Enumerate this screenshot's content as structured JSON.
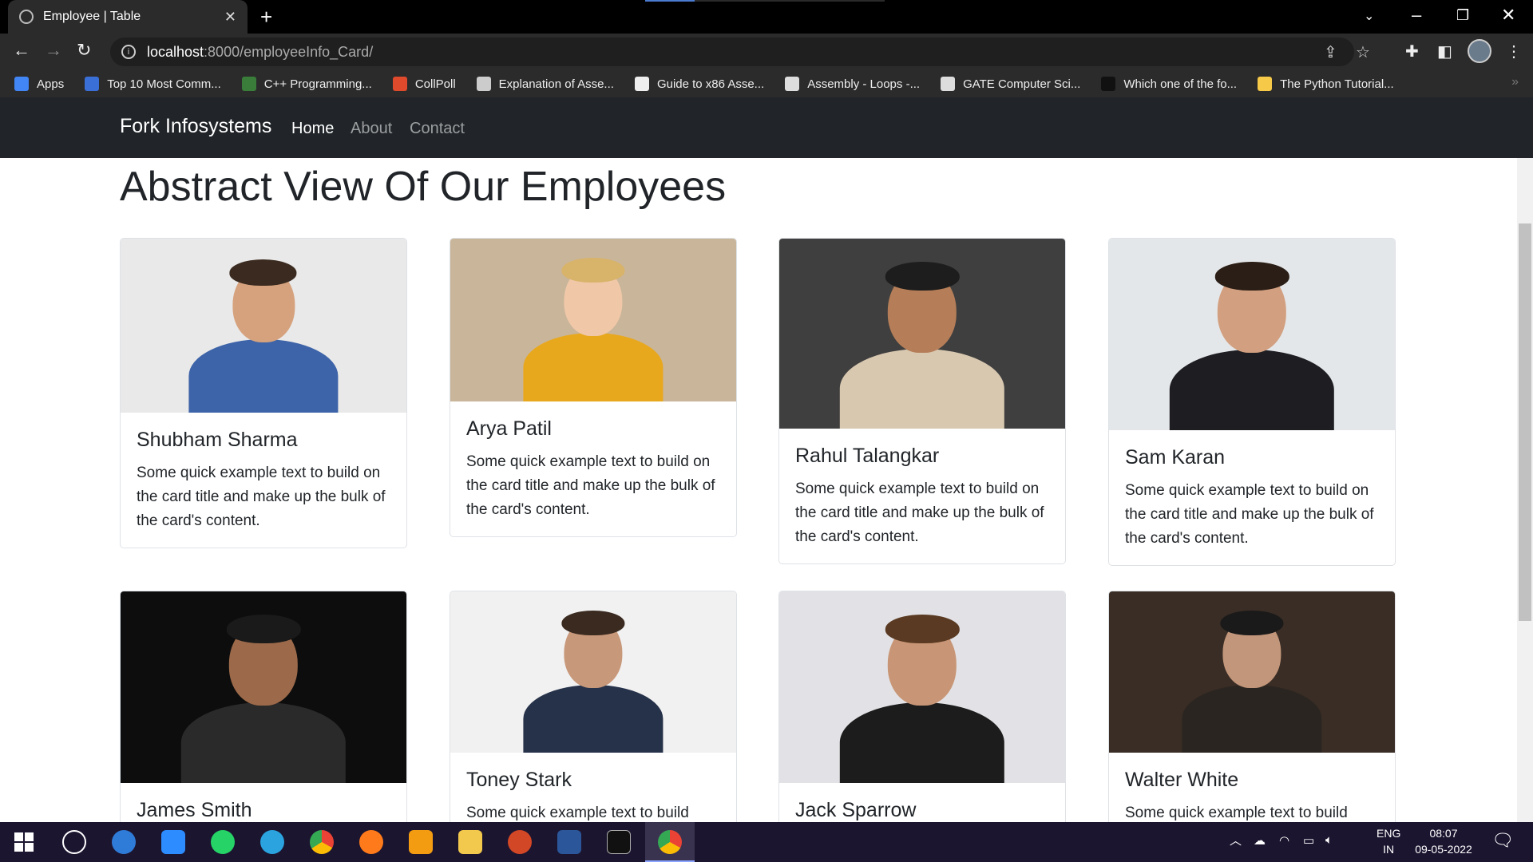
{
  "browser": {
    "tab_title": "Employee | Table",
    "url_host": "localhost",
    "url_rest": ":8000/employeeInfo_Card/",
    "bookmarks": [
      {
        "label": "Apps",
        "color": "#4285f4"
      },
      {
        "label": "Top 10 Most Comm...",
        "color": "#3b6fd8"
      },
      {
        "label": "C++ Programming...",
        "color": "#3a7d3a"
      },
      {
        "label": "CollPoll",
        "color": "#e04a2c"
      },
      {
        "label": "Explanation of Asse...",
        "color": "#cccccc"
      },
      {
        "label": "Guide to x86 Asse...",
        "color": "#eeeeee"
      },
      {
        "label": "Assembly - Loops -...",
        "color": "#dddddd"
      },
      {
        "label": "GATE Computer Sci...",
        "color": "#dddddd"
      },
      {
        "label": "Which one of the fo...",
        "color": "#111111"
      },
      {
        "label": "The Python Tutorial...",
        "color": "#f7c948"
      }
    ]
  },
  "site": {
    "brand": "Fork Infosystems",
    "nav": [
      {
        "label": "Home",
        "active": true
      },
      {
        "label": "About",
        "active": false
      },
      {
        "label": "Contact",
        "active": false
      }
    ],
    "heading": "Abstract View Of Our Employees"
  },
  "employees": [
    {
      "name": "Shubham Sharma",
      "text": "Some quick example text to build on the card title and make up the bulk of the card's content.",
      "bg": "#e9e9e9",
      "shirt": "#3d63a8",
      "skin": "#d6a27e",
      "hair": "#3b2a1f"
    },
    {
      "name": "Arya Patil",
      "text": "Some quick example text to build on the card title and make up the bulk of the card's content.",
      "bg": "#c9b59a",
      "shirt": "#e8a81e",
      "skin": "#f0c8a8",
      "hair": "#d8b36a"
    },
    {
      "name": "Rahul Talangkar",
      "text": "Some quick example text to build on the card title and make up the bulk of the card's content.",
      "bg": "#3f3f3f",
      "shirt": "#d8c8b0",
      "skin": "#b57e58",
      "hair": "#1d1d1d"
    },
    {
      "name": "Sam Karan",
      "text": "Some quick example text to build on the card title and make up the bulk of the card's content.",
      "bg": "#e4e7ea",
      "shirt": "#1e1e22",
      "skin": "#d2a080",
      "hair": "#2a1e16"
    },
    {
      "name": "James Smith",
      "text": "",
      "bg": "#0d0d0d",
      "shirt": "#2a2a2a",
      "skin": "#9c6a4a",
      "hair": "#1a1a1a"
    },
    {
      "name": "Toney Stark",
      "text": "Some quick example text to build",
      "bg": "#f1f1f1",
      "shirt": "#26324a",
      "skin": "#c8987a",
      "hair": "#3a2a20"
    },
    {
      "name": "Jack Sparrow",
      "text": "",
      "bg": "#e2e2e6",
      "shirt": "#1c1c1c",
      "skin": "#c89676",
      "hair": "#5a3a22"
    },
    {
      "name": "Walter White",
      "text": "Some quick example text to build",
      "bg": "#3a2d25",
      "shirt": "#2a2520",
      "skin": "#c2967a",
      "hair": "#1a1a1a"
    }
  ],
  "taskbar": {
    "lang_line1": "ENG",
    "lang_line2": "IN",
    "time": "08:07",
    "date": "09-05-2022"
  }
}
